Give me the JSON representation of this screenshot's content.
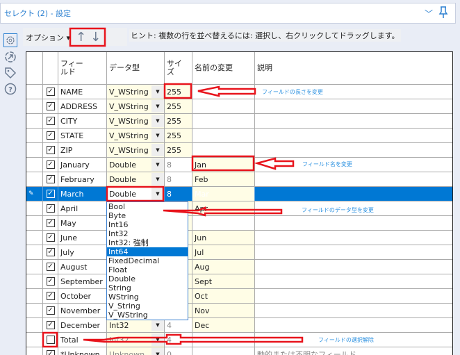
{
  "window": {
    "title": "セレクト (2) - 設定",
    "collapse_icon": "chevron-down-icon",
    "pin_icon": "pin-icon"
  },
  "sidebar": {
    "icons": [
      "gear-icon",
      "connection-icon",
      "tag-icon",
      "help-icon"
    ]
  },
  "toolbar": {
    "options_label": "オプション ▾",
    "up_icon": "↑",
    "down_icon": "↓",
    "hint": "ヒント: 複数の行を並べ替えるには: 選択し、右クリックしてドラッグします。"
  },
  "grid": {
    "headers": [
      "",
      "",
      "フィールド",
      "データ型",
      "サイズ",
      "名前の変更",
      "説明"
    ],
    "rows": [
      {
        "checked": true,
        "field": "NAME",
        "type": "V_WString",
        "size": "255",
        "rename": "",
        "desc": ""
      },
      {
        "checked": true,
        "field": "ADDRESS",
        "type": "V_WString",
        "size": "255",
        "rename": "",
        "desc": ""
      },
      {
        "checked": true,
        "field": "CITY",
        "type": "V_WString",
        "size": "255",
        "rename": "",
        "desc": ""
      },
      {
        "checked": true,
        "field": "STATE",
        "type": "V_WString",
        "size": "255",
        "rename": "",
        "desc": ""
      },
      {
        "checked": true,
        "field": "ZIP",
        "type": "V_WString",
        "size": "255",
        "rename": "",
        "desc": ""
      },
      {
        "checked": true,
        "field": "January",
        "type": "Double",
        "size": "8",
        "rename": "Jan",
        "desc": ""
      },
      {
        "checked": true,
        "field": "February",
        "type": "Double",
        "size": "8",
        "rename": "Feb",
        "desc": ""
      },
      {
        "checked": true,
        "field": "March",
        "type": "Double",
        "size": "8",
        "rename": "Mar",
        "desc": "",
        "selected": true
      },
      {
        "checked": true,
        "field": "April",
        "type": "",
        "size": "",
        "rename": "Apr",
        "desc": ""
      },
      {
        "checked": true,
        "field": "May",
        "type": "",
        "size": "",
        "rename": "",
        "desc": ""
      },
      {
        "checked": true,
        "field": "June",
        "type": "",
        "size": "",
        "rename": "Jun",
        "desc": ""
      },
      {
        "checked": true,
        "field": "July",
        "type": "",
        "size": "",
        "rename": "Jul",
        "desc": ""
      },
      {
        "checked": true,
        "field": "August",
        "type": "",
        "size": "",
        "rename": "Aug",
        "desc": ""
      },
      {
        "checked": true,
        "field": "September",
        "type": "",
        "size": "",
        "rename": "Sept",
        "desc": ""
      },
      {
        "checked": true,
        "field": "October",
        "type": "",
        "size": "",
        "rename": "Oct",
        "desc": ""
      },
      {
        "checked": true,
        "field": "November",
        "type": "",
        "size": "",
        "rename": "Nov",
        "desc": ""
      },
      {
        "checked": true,
        "field": "December",
        "type": "Int32",
        "size": "4",
        "rename": "Dec",
        "desc": ""
      },
      {
        "checked": false,
        "field": "Total",
        "type": "Int32",
        "size": "4",
        "rename": "",
        "desc": ""
      },
      {
        "checked": true,
        "field": "*Unknown",
        "type": "Unknown",
        "size": "0",
        "rename": "",
        "desc": "動的または不明なフィールド"
      }
    ]
  },
  "dropdown": {
    "options": [
      "Bool",
      "Byte",
      "Int16",
      "Int32",
      "Int32: 強制",
      "Int64",
      "FixedDecimal",
      "Float",
      "Double",
      "String",
      "WString",
      "V_String",
      "V_WString"
    ],
    "highlighted": "Int64"
  },
  "annotations": {
    "size": "フィールドの長さを変更",
    "rename": "フィールド名を変更",
    "type": "フィールドのデータ型を変更",
    "deselect": "フィールドの選択解除"
  },
  "colors": {
    "accent": "#0078d4",
    "annotation": "#e8141c",
    "note": "#2a90e0",
    "editable": "#fffde6"
  }
}
